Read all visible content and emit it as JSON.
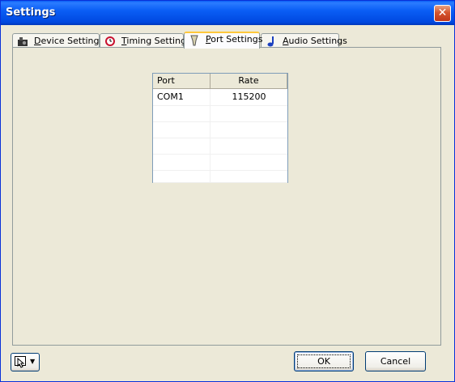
{
  "window": {
    "title": "Settings",
    "close_glyph": "✕"
  },
  "tabs": [
    {
      "label": "Device Settings",
      "icon": "device-icon",
      "accel": "D",
      "active": false
    },
    {
      "label": "Timing Settings",
      "icon": "timing-icon",
      "accel": "T",
      "active": false
    },
    {
      "label": "Port Settings",
      "icon": "port-icon",
      "accel": "P",
      "active": true
    },
    {
      "label": "Audio Settings",
      "icon": "audio-icon",
      "accel": "A",
      "active": false
    }
  ],
  "port_table": {
    "columns": [
      "Port",
      "Rate"
    ],
    "rows": [
      [
        "COM1",
        "115200"
      ],
      [
        "",
        ""
      ],
      [
        "",
        ""
      ],
      [
        "",
        ""
      ],
      [
        "",
        ""
      ],
      [
        "",
        ""
      ]
    ]
  },
  "buttons": {
    "ok": "OK",
    "cancel": "Cancel"
  },
  "colors": {
    "title_bar": "#0a5ef5",
    "active_tab_accent": "#ffc83c",
    "face": "#ece9d8"
  }
}
